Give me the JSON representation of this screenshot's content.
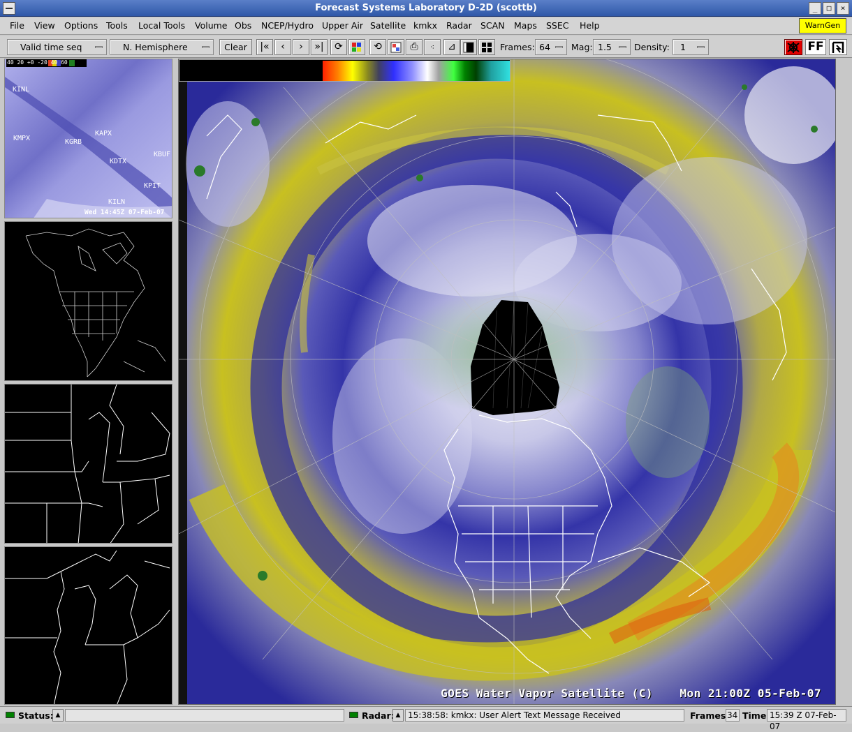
{
  "window": {
    "title": "Forecast Systems Laboratory D-2D (scottb)",
    "minimize": "_",
    "maximize": "□",
    "close": "×"
  },
  "menu": {
    "items": [
      "File",
      "View",
      "Options",
      "Tools",
      "Local Tools",
      "Volume",
      "Obs",
      "NCEP/Hydro",
      "Upper Air",
      "Satellite",
      "kmkx",
      "Radar",
      "SCAN",
      "Maps",
      "SSEC",
      "Help"
    ],
    "warngen": "WarnGen"
  },
  "toolbar": {
    "time_mode": "Valid time seq",
    "scale": "N. Hemisphere",
    "clear": "Clear",
    "frames_label": "Frames:",
    "frames_value": "64",
    "mag_label": "Mag:",
    "mag_value": "1.5",
    "density_label": "Density:",
    "density_value": "1",
    "ff_label": "FF"
  },
  "side_panes": {
    "pane1": {
      "scale_text": "40 20 +0 -20 40 60",
      "stations": [
        "KINL",
        "KMPX",
        "KGRB",
        "KAPX",
        "KDTX",
        "KBUF",
        "KPIT",
        "KILN"
      ],
      "timestamp": "Wed 14:45Z 07-Feb-07"
    }
  },
  "main_pane": {
    "product_label": "GOES Water Vapor Satellite (C)",
    "time_label": "Mon 21:00Z 05-Feb-07"
  },
  "status": {
    "status_label": "Status:",
    "radar_label": "Radar:",
    "radar_message": "15:38:58: kmkx: User Alert Text Message Received",
    "frames_label": "Frames:",
    "frames_value": "34",
    "time_label": "Time:",
    "time_value": "15:39 Z 07-Feb-07"
  },
  "colors": {
    "titlebar": "#2f58a8",
    "warngen": "#ffff00",
    "status_led": "#008000",
    "water_vapor_blue": "#2a2a9a",
    "water_vapor_yellow": "#c8c020"
  }
}
